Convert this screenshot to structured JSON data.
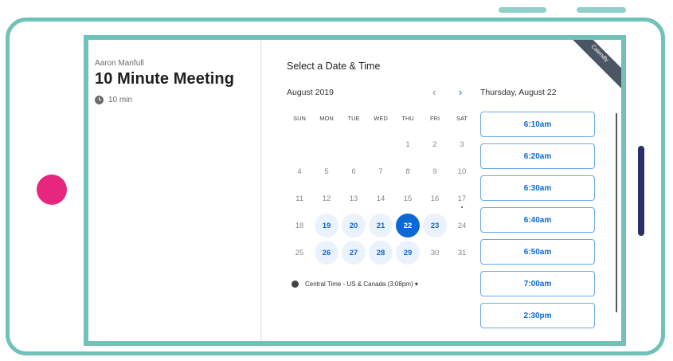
{
  "colors": {
    "device_border": "#6fc2b8",
    "accent": "#0b69d6",
    "home_dot": "#e6267f",
    "side_button": "#2c2e6a"
  },
  "event": {
    "host": "Aaron Manfull",
    "title": "10 Minute Meeting",
    "duration": "10 min"
  },
  "scheduler": {
    "heading": "Select a Date & Time",
    "month": "August 2019",
    "prev_icon": "‹",
    "next_icon": "›",
    "selected_day_label": "Thursday, August 22",
    "weekdays": [
      "SUN",
      "MON",
      "TUE",
      "WED",
      "THU",
      "FRI",
      "SAT"
    ],
    "weeks": [
      [
        "",
        "",
        "",
        "",
        "1",
        "2",
        "3"
      ],
      [
        "4",
        "5",
        "6",
        "7",
        "8",
        "9",
        "10"
      ],
      [
        "11",
        "12",
        "13",
        "14",
        "15",
        "16",
        "17"
      ],
      [
        "18",
        "19",
        "20",
        "21",
        "22",
        "23",
        "24"
      ],
      [
        "25",
        "26",
        "27",
        "28",
        "29",
        "30",
        "31"
      ]
    ],
    "available_days": [
      "19",
      "20",
      "21",
      "23",
      "26",
      "27",
      "28",
      "29"
    ],
    "selected_day": "22",
    "dot_day": "17",
    "timezone": "Central Time - US & Canada (3:08pm) ▾",
    "slots": [
      "6:10am",
      "6:20am",
      "6:30am",
      "6:40am",
      "6:50am",
      "7:00am",
      "2:30pm"
    ]
  },
  "badge": {
    "text": "Calendly"
  }
}
